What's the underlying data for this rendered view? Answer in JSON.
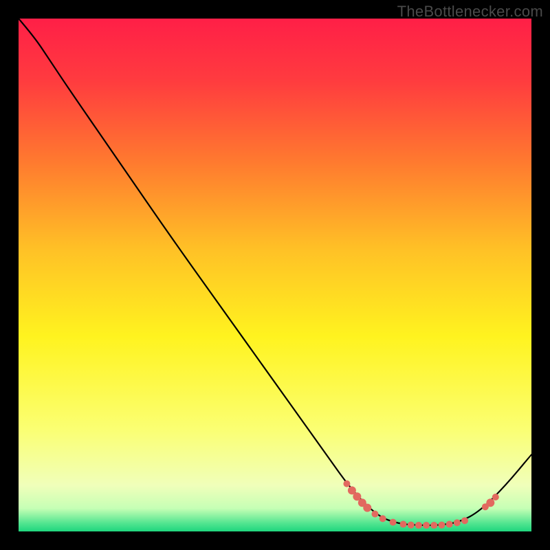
{
  "watermark": "TheBottlenecker.com",
  "chart_data": {
    "type": "line",
    "title": "",
    "xlabel": "",
    "ylabel": "",
    "xlim": [
      0,
      100
    ],
    "ylim": [
      0,
      100
    ],
    "grid": false,
    "legend": null,
    "background_gradient_stops": [
      {
        "t": 0.0,
        "color": "#ff1f47"
      },
      {
        "t": 0.12,
        "color": "#ff3b3f"
      },
      {
        "t": 0.28,
        "color": "#ff7a2f"
      },
      {
        "t": 0.45,
        "color": "#ffc126"
      },
      {
        "t": 0.62,
        "color": "#fff31f"
      },
      {
        "t": 0.8,
        "color": "#fbff72"
      },
      {
        "t": 0.91,
        "color": "#f0ffba"
      },
      {
        "t": 0.955,
        "color": "#c6ffb5"
      },
      {
        "t": 0.985,
        "color": "#4fe48f"
      },
      {
        "t": 1.0,
        "color": "#1fd67e"
      }
    ],
    "series": [
      {
        "name": "curve",
        "color": "#000000",
        "points": [
          {
            "x": 0.0,
            "y": 100.0
          },
          {
            "x": 3.0,
            "y": 96.5
          },
          {
            "x": 6.0,
            "y": 92.0
          },
          {
            "x": 10.0,
            "y": 86.0
          },
          {
            "x": 20.0,
            "y": 71.5
          },
          {
            "x": 30.0,
            "y": 57.0
          },
          {
            "x": 40.0,
            "y": 43.0
          },
          {
            "x": 50.0,
            "y": 29.0
          },
          {
            "x": 60.0,
            "y": 15.0
          },
          {
            "x": 65.0,
            "y": 8.0
          },
          {
            "x": 70.0,
            "y": 3.0
          },
          {
            "x": 74.0,
            "y": 1.5
          },
          {
            "x": 78.0,
            "y": 1.2
          },
          {
            "x": 82.0,
            "y": 1.2
          },
          {
            "x": 86.0,
            "y": 1.8
          },
          {
            "x": 90.0,
            "y": 4.0
          },
          {
            "x": 95.0,
            "y": 9.0
          },
          {
            "x": 100.0,
            "y": 15.0
          }
        ]
      }
    ],
    "markers": {
      "name": "highlight-dots",
      "color": "#e2695f",
      "points": [
        {
          "x": 64.0,
          "y": 9.3,
          "r": 5
        },
        {
          "x": 65.0,
          "y": 8.0,
          "r": 6
        },
        {
          "x": 66.0,
          "y": 6.8,
          "r": 6
        },
        {
          "x": 67.0,
          "y": 5.6,
          "r": 6
        },
        {
          "x": 68.0,
          "y": 4.6,
          "r": 6
        },
        {
          "x": 69.5,
          "y": 3.4,
          "r": 5
        },
        {
          "x": 71.0,
          "y": 2.5,
          "r": 5
        },
        {
          "x": 73.0,
          "y": 1.8,
          "r": 5
        },
        {
          "x": 75.0,
          "y": 1.4,
          "r": 5
        },
        {
          "x": 76.5,
          "y": 1.25,
          "r": 5
        },
        {
          "x": 78.0,
          "y": 1.2,
          "r": 5
        },
        {
          "x": 79.5,
          "y": 1.2,
          "r": 5
        },
        {
          "x": 81.0,
          "y": 1.2,
          "r": 5
        },
        {
          "x": 82.5,
          "y": 1.25,
          "r": 5
        },
        {
          "x": 84.0,
          "y": 1.4,
          "r": 5
        },
        {
          "x": 85.5,
          "y": 1.7,
          "r": 5
        },
        {
          "x": 87.0,
          "y": 2.1,
          "r": 5
        },
        {
          "x": 91.0,
          "y": 4.8,
          "r": 5
        },
        {
          "x": 92.0,
          "y": 5.6,
          "r": 6
        },
        {
          "x": 93.0,
          "y": 6.7,
          "r": 5
        }
      ]
    }
  }
}
